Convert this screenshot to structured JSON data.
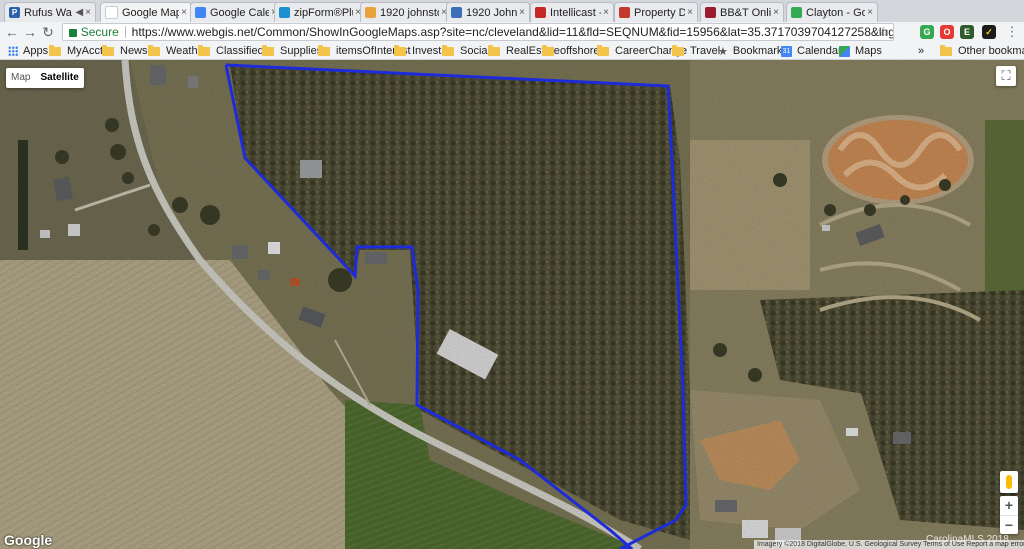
{
  "tabs": [
    {
      "title": "Rufus Wa",
      "favicon_letter": "P",
      "favicon_color": "#2962a8",
      "muted": true
    },
    {
      "title": "Google Maps",
      "favicon_letter": "",
      "favicon_color": "#ffffff",
      "active": true
    },
    {
      "title": "Google Cale",
      "favicon_letter": "",
      "favicon_color": "#4285f4"
    },
    {
      "title": "zipForm®Plu",
      "favicon_letter": "",
      "favicon_color": "#1c8fd0"
    },
    {
      "title": "1920 johnsto",
      "favicon_letter": "",
      "favicon_color": "#e8a33d"
    },
    {
      "title": "1920 Johnsto",
      "favicon_letter": "",
      "favicon_color": "#3b6fb6"
    },
    {
      "title": "Intellicast - C",
      "favicon_letter": "",
      "favicon_color": "#c62828"
    },
    {
      "title": "Property Det",
      "favicon_letter": "",
      "favicon_color": "#c0392b"
    },
    {
      "title": "BB&T Online",
      "favicon_letter": "",
      "favicon_color": "#9b1c2e"
    },
    {
      "title": "Clayton - Go",
      "favicon_letter": "",
      "favicon_color": "#34a853"
    }
  ],
  "toolbar": {
    "secure_label": "Secure",
    "url": "https://www.webgis.net/Common/ShowInGoogleMaps.asp?site=nc/cleveland&lid=11&fld=SEQNUM&fid=15956&lat=35.3717039704127258&lng=-81.43556417008826"
  },
  "bookmarks": [
    {
      "label": "Apps",
      "kind": "apps"
    },
    {
      "label": "MyAccts",
      "kind": "folder"
    },
    {
      "label": "News",
      "kind": "folder"
    },
    {
      "label": "Weather",
      "kind": "folder"
    },
    {
      "label": "Classifieds",
      "kind": "folder"
    },
    {
      "label": "Supplies",
      "kind": "folder"
    },
    {
      "label": "itemsOfInterest",
      "kind": "folder"
    },
    {
      "label": "Invest",
      "kind": "folder"
    },
    {
      "label": "Social",
      "kind": "folder"
    },
    {
      "label": "RealEstate",
      "kind": "folder"
    },
    {
      "label": "offshore",
      "kind": "folder"
    },
    {
      "label": "CareerChange",
      "kind": "folder"
    },
    {
      "label": "Travel",
      "kind": "folder"
    },
    {
      "label": "Bookmarks",
      "kind": "star"
    },
    {
      "label": "Calendar",
      "kind": "calendar"
    },
    {
      "label": "Maps",
      "kind": "maps"
    },
    {
      "label": "Other bookmarks",
      "kind": "folder"
    }
  ],
  "overflow_label": "»",
  "map": {
    "type_map_label": "Map",
    "type_satellite_label": "Satellite",
    "zoom_in": "+",
    "zoom_out": "−",
    "logo": "Google",
    "attribution": "Imagery ©2018 DigitalGlobe, U.S. Geological Survey   Terms of Use   Report a map error",
    "watermark": "CarolinaMLS 2018",
    "boundary_color": "#1d2bd8"
  }
}
